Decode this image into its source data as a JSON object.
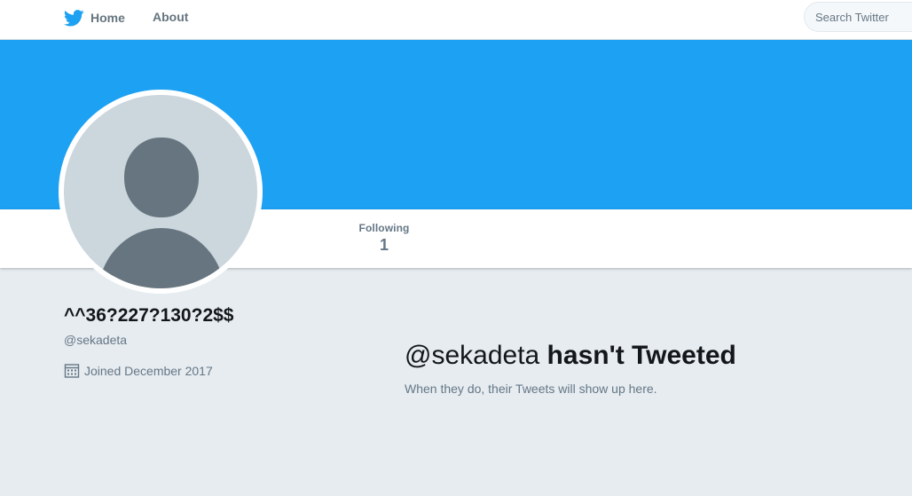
{
  "nav": {
    "home_label": "Home",
    "about_label": "About",
    "search_placeholder": "Search Twitter"
  },
  "colors": {
    "brand": "#1da1f2",
    "background": "#e6ecf0",
    "muted_text": "#657786"
  },
  "stats": {
    "following_label": "Following",
    "following_count": "1"
  },
  "profile": {
    "name": "^^36?227?130?2$$",
    "handle": "@sekadeta",
    "joined": "Joined December 2017"
  },
  "empty_state": {
    "handle": "@sekadeta",
    "title_rest": " hasn't Tweeted",
    "subtitle": "When they do, their Tweets will show up here."
  },
  "icons": {
    "logo": "twitter-bird-icon",
    "calendar": "calendar-icon",
    "avatar": "default-avatar-icon"
  }
}
